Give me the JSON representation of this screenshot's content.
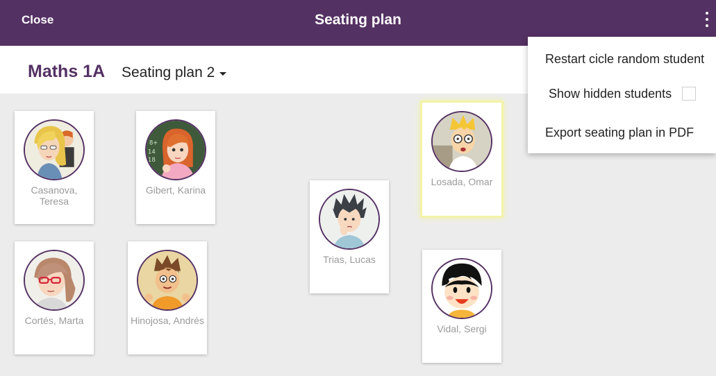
{
  "header": {
    "close_label": "Close",
    "title": "Seating plan",
    "background": "#543163"
  },
  "subheader": {
    "class_name": "Maths 1A",
    "plan_name": "Seating plan 2"
  },
  "menu": {
    "restart_label": "Restart cicle random student",
    "show_hidden_label": "Show hidden students",
    "show_hidden_checked": false,
    "export_label": "Export seating plan in PDF"
  },
  "students": [
    {
      "name": "Casanova, Teresa",
      "highlighted": false
    },
    {
      "name": "Gibert, Karina",
      "highlighted": false
    },
    {
      "name": "Trias, Lucas",
      "highlighted": false
    },
    {
      "name": "Losada, Omar",
      "highlighted": true
    },
    {
      "name": "Cortés, Marta",
      "highlighted": false
    },
    {
      "name": "Hinojosa, Andrés",
      "highlighted": false
    },
    {
      "name": "Vidal, Sergi",
      "highlighted": false
    }
  ]
}
